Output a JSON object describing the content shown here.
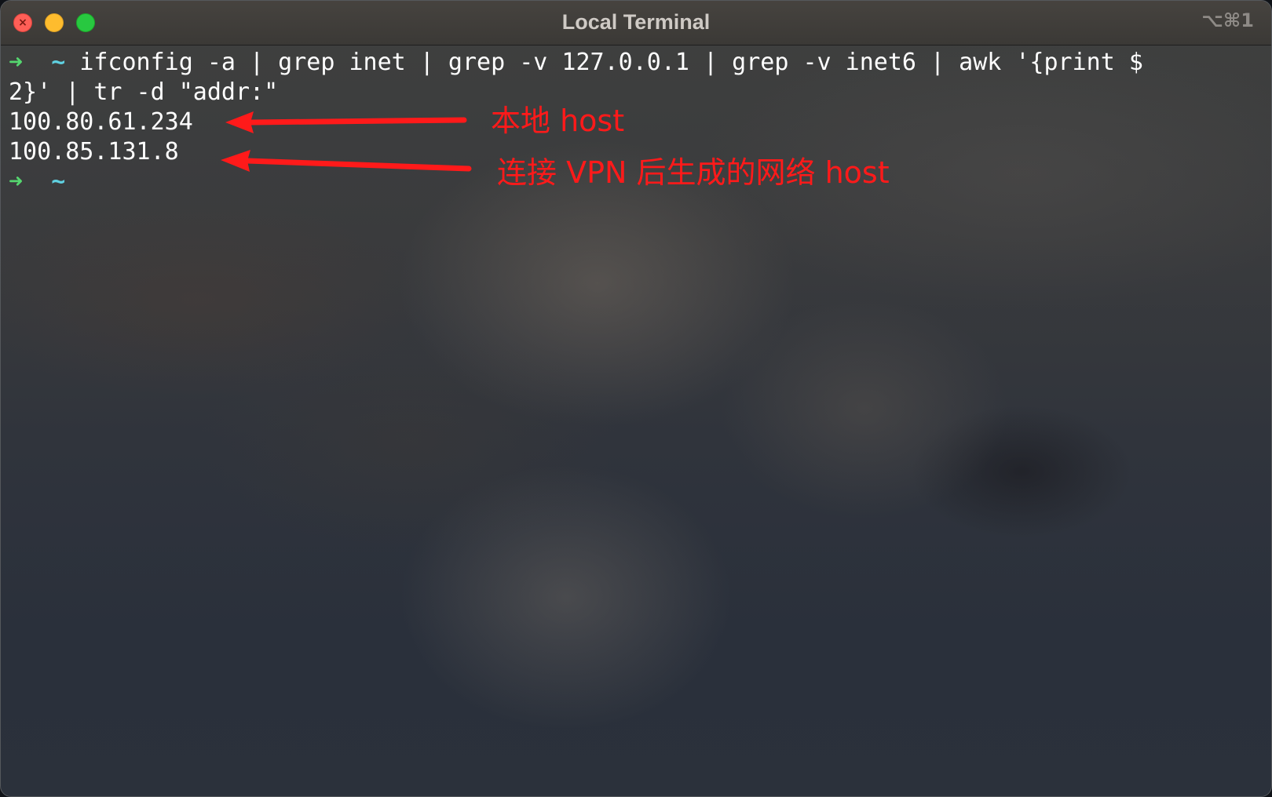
{
  "window": {
    "title": "Local Terminal",
    "shortcut": "⌥⌘1",
    "close_glyph": "×"
  },
  "terminal": {
    "prompt_arrow": "➜",
    "prompt_dir": "~",
    "command_line1": "ifconfig -a | grep inet | grep -v 127.0.0.1 | grep -v inet6 | awk '{print $",
    "command_line2": "2}' | tr -d \"addr:\"",
    "output": [
      "100.80.61.234",
      "100.85.131.8"
    ]
  },
  "annotations": {
    "local_host": "本地 host",
    "vpn_host": "连接 VPN 后生成的网络 host",
    "color": "#ff1a1a"
  },
  "colors": {
    "prompt_arrow": "#55d66f",
    "prompt_dir": "#5fd0e0",
    "close": "#fe5f57",
    "minimize": "#febc2e",
    "zoom": "#28c840"
  }
}
